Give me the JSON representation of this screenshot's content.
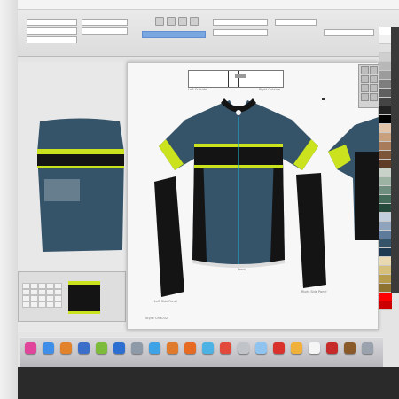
{
  "app": {
    "panel_labels": [
      "",
      "",
      "",
      ""
    ]
  },
  "artboard": {
    "label_left_outside": "Left Outside",
    "label_right_outside": "Right Outside",
    "label_front": "Front",
    "label_left_side": "Left Side Panel",
    "label_right_side": "Right Side Panel",
    "label_sizes": "Style: CRB032"
  },
  "colors": {
    "jersey_blue": "#35546a",
    "accent_green": "#cbe31e",
    "black": "#141414",
    "zipper": "#1fa7c9",
    "swatches": [
      "#ffffff",
      "#f1f1f1",
      "#e0e0e0",
      "#cfcfcf",
      "#b8b8b8",
      "#9c9c9c",
      "#7e7e7e",
      "#606060",
      "#444444",
      "#222222",
      "#000000",
      "#e3c4a8",
      "#c8a07e",
      "#a87c5a",
      "#7d563a",
      "#5e3b24",
      "#c9d2c8",
      "#9cb3a3",
      "#6f8e7f",
      "#456b5b",
      "#254a3b",
      "#c2cedb",
      "#8fa4bc",
      "#5e7b9c",
      "#35546a",
      "#1d3a52",
      "#e8d9b2",
      "#d6be7b",
      "#b89c4e",
      "#8d7230",
      "#ff0000",
      "#cc0000"
    ]
  },
  "dock": {
    "icons": [
      {
        "name": "itunes-icon",
        "color": "#e0449b"
      },
      {
        "name": "finder-icon",
        "color": "#3f8ee8"
      },
      {
        "name": "illustrator-icon",
        "color": "#e2822a"
      },
      {
        "name": "photoshop-icon",
        "color": "#3a6ec9"
      },
      {
        "name": "app-green-icon",
        "color": "#7dbb3a"
      },
      {
        "name": "app-blue-icon",
        "color": "#2c6fd0"
      },
      {
        "name": "app-grey-icon",
        "color": "#8e9aa8"
      },
      {
        "name": "safari-icon",
        "color": "#3da3e6"
      },
      {
        "name": "app-orange-icon",
        "color": "#e07a2c"
      },
      {
        "name": "firefox-icon",
        "color": "#e76a22"
      },
      {
        "name": "app-sky-icon",
        "color": "#4cb2e3"
      },
      {
        "name": "chrome-icon",
        "color": "#e34a3c"
      },
      {
        "name": "app-silver-icon",
        "color": "#c0c4c9"
      },
      {
        "name": "app-lightblue-icon",
        "color": "#8ec4ef"
      },
      {
        "name": "pdf-icon",
        "color": "#d9322c"
      },
      {
        "name": "notes-icon",
        "color": "#f0b13a"
      },
      {
        "name": "calendar-icon",
        "color": "#f5f5f5"
      },
      {
        "name": "app-red-icon",
        "color": "#c72a2a"
      },
      {
        "name": "app-brown-icon",
        "color": "#8b5a2b"
      },
      {
        "name": "trash-icon",
        "color": "#9aa3ad"
      }
    ]
  }
}
